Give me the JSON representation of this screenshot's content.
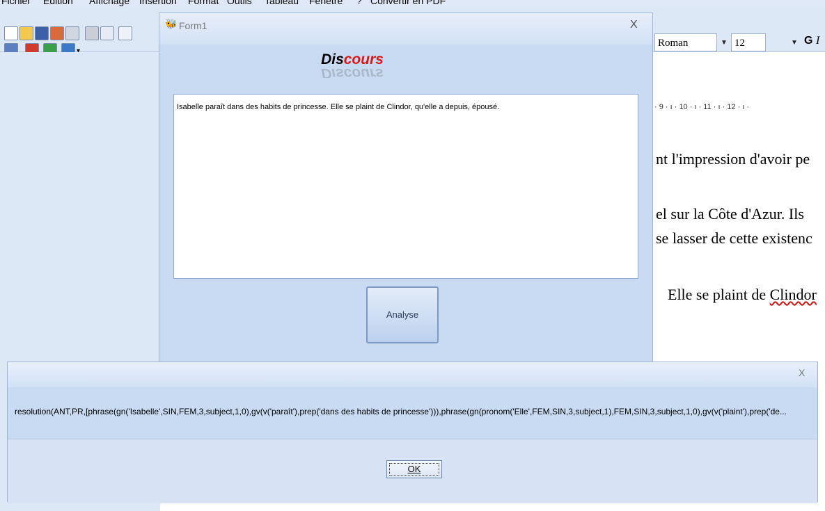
{
  "app": {
    "menu": [
      "Fichier",
      "Edition",
      "Affichage",
      "Insertion",
      "Format",
      "Outils",
      "Tableau",
      "Fenêtre",
      "?",
      "Convertir en PDF"
    ],
    "font_name": "Roman",
    "font_size": "12",
    "bold_label": "G",
    "italic_label": "I",
    "ruler_text": "· 9 · ı · 10 · ı · 11 · ı · 12 · ı ·",
    "doc_lines": [
      "nt l'impression d'avoir pe",
      "el sur la Côte d'Azur. Ils",
      "se lasser de cette existenc",
      "Elle se plaint de Clindor"
    ],
    "underlined_word": "Clindor"
  },
  "form1": {
    "title": "Form1",
    "close_label": "X",
    "logo_part1": "Dis",
    "logo_part2": "cours",
    "logo_reflection": "Discours",
    "input_text": "Isabelle paraît dans des habits de princesse. Elle se plaint de Clindor, qu'elle a depuis, épousé.",
    "analyse_button": "Analyse"
  },
  "dialog": {
    "close_label": "X",
    "message": "resolution(ANT,PR,[phrase(gn('Isabelle',SIN,FEM,3,subject,1,0),gv(v('paraît'),prep('dans des habits de princesse'))),phrase(gn(pronom('Elle',FEM,SIN,3,subject,1),FEM,SIN,3,subject,1,0),gv(v('plaint'),prep('de...",
    "ok_button": "OK"
  },
  "colors": {
    "window_bg": "#c9dbf3",
    "logo_red": "#d21a1a"
  }
}
